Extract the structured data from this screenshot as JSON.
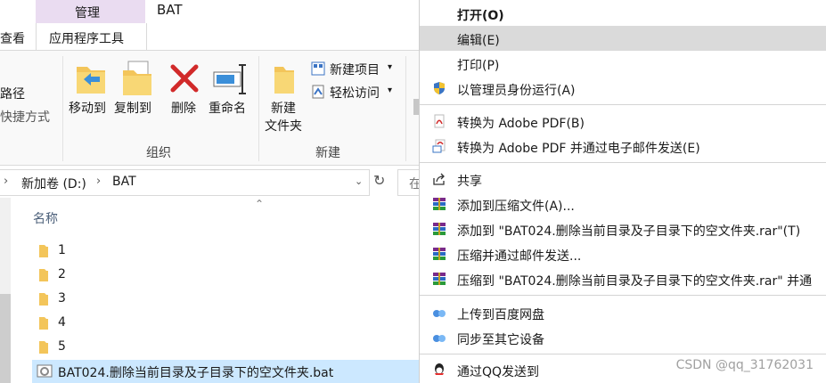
{
  "explorer": {
    "tabs": {
      "view_partial": "查看",
      "manage": "管理",
      "app_tools": "应用程序工具",
      "window_title": "BAT"
    },
    "ribbon": {
      "path_partial": "路径",
      "shortcut_partial": "快捷方式",
      "move_to": "移动到",
      "copy_to": "复制到",
      "delete": "删除",
      "rename": "重命名",
      "organize_group": "组织",
      "new_folder_line1": "新建",
      "new_folder_line2": "文件夹",
      "new_item": "新建项目",
      "easy_access": "轻松访问",
      "new_group": "新建"
    },
    "address": {
      "drive": "新加卷 (D:)",
      "folder": "BAT",
      "search_partial": "在"
    },
    "list": {
      "column_name": "名称",
      "items": [
        {
          "name": "1",
          "type": "folder"
        },
        {
          "name": "2",
          "type": "folder"
        },
        {
          "name": "3",
          "type": "folder"
        },
        {
          "name": "4",
          "type": "folder"
        },
        {
          "name": "5",
          "type": "folder"
        },
        {
          "name": "BAT024.删除当前目录及子目录下的空文件夹.bat",
          "type": "bat",
          "selected": true
        }
      ]
    }
  },
  "context_menu": {
    "items": [
      {
        "label": "打开(O)",
        "bold": true
      },
      {
        "label": "编辑(E)",
        "highlighted": true
      },
      {
        "label": "打印(P)"
      },
      {
        "label": "以管理员身份运行(A)",
        "icon": "shield-icon"
      },
      {
        "label": "转换为 Adobe PDF(B)",
        "icon": "pdf-icon"
      },
      {
        "label": "转换为 Adobe PDF 并通过电子邮件发送(E)",
        "icon": "pdf-mail-icon"
      },
      {
        "label": "共享",
        "icon": "share-icon"
      },
      {
        "label": "添加到压缩文件(A)...",
        "icon": "winrar-icon"
      },
      {
        "label": "添加到 \"BAT024.删除当前目录及子目录下的空文件夹.rar\"(T)",
        "icon": "winrar-icon"
      },
      {
        "label": "压缩并通过邮件发送...",
        "icon": "winrar-icon"
      },
      {
        "label": "压缩到 \"BAT024.删除当前目录及子目录下的空文件夹.rar\" 并通",
        "icon": "winrar-icon"
      },
      {
        "label": "上传到百度网盘",
        "icon": "baidu-cloud-icon"
      },
      {
        "label": "同步至其它设备",
        "icon": "baidu-cloud-icon"
      },
      {
        "label": "通过QQ发送到",
        "icon": "qq-icon"
      }
    ]
  },
  "watermark": "CSDN @qq_31762031",
  "colors": {
    "manage_tab": "#eadcf1",
    "selection": "#cce8ff",
    "menu_hover": "#dadada"
  }
}
